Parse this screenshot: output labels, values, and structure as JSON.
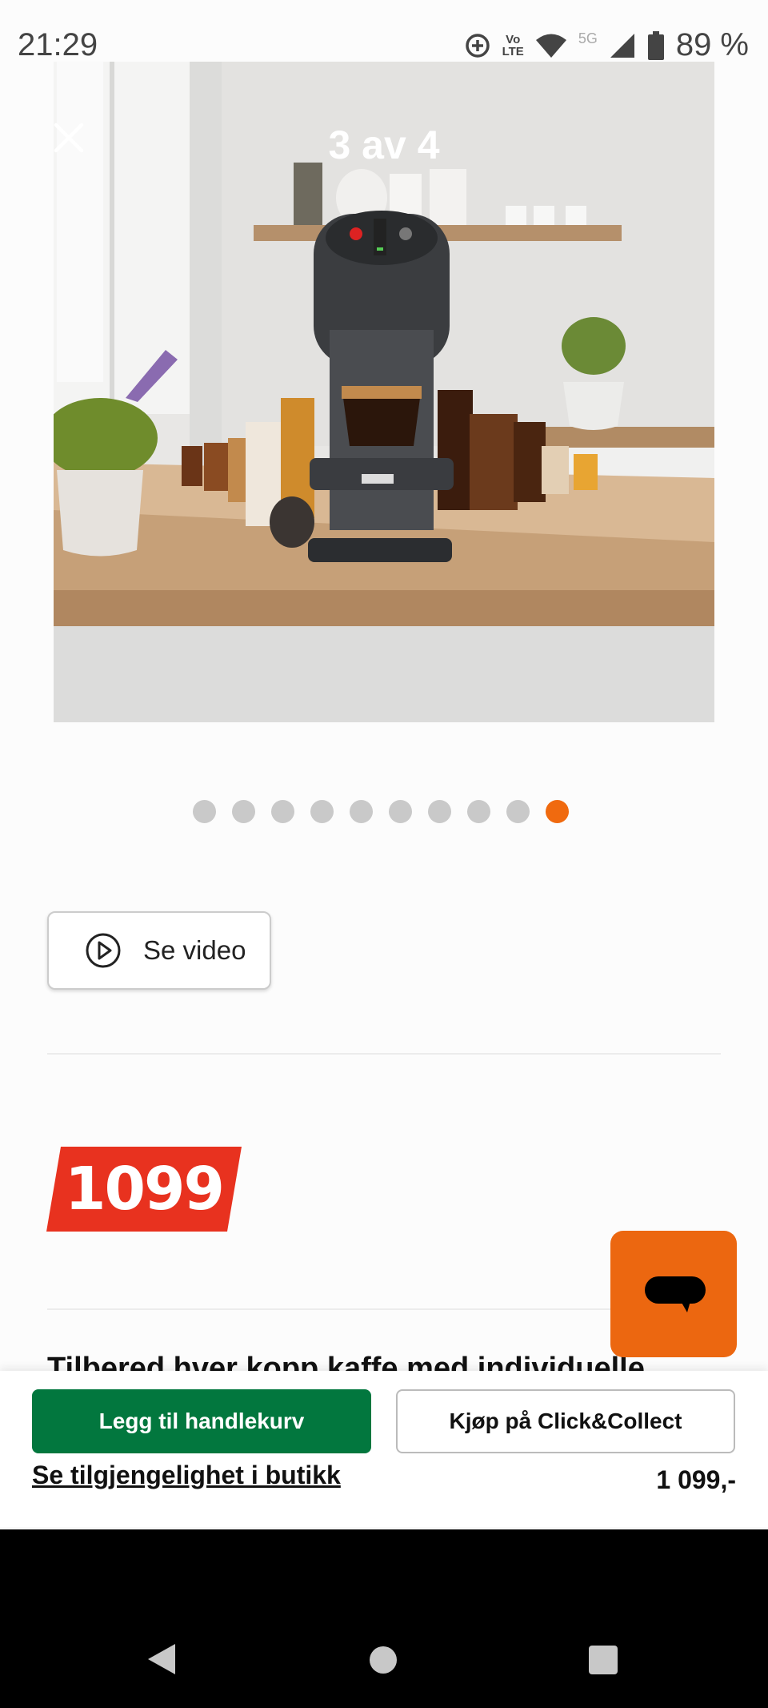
{
  "status_bar": {
    "time": "21:29",
    "network_label_top": "Vo",
    "network_label_bottom": "LTE",
    "fiveg": "5G",
    "battery": "89 %",
    "icons": [
      "data-saver-icon",
      "volte-icon",
      "wifi-icon",
      "signal-icon",
      "battery-icon"
    ]
  },
  "gallery": {
    "counter": "3 av 4",
    "close_icon": "close-icon",
    "image_name": "dolce-gusto-coffee-machine-kitchen-photo",
    "dot_count": 10,
    "active_dot": 9
  },
  "video_button": {
    "label": "Se video",
    "icon": "play-circle-icon"
  },
  "price": {
    "value": "1099",
    "tag_color": "#e8321f"
  },
  "description_peek": "Tilbered hver kopp kaffe med individuelle",
  "chat_button": {
    "icon": "chat-bubble-icon",
    "color": "#ec6710"
  },
  "bottom_bar": {
    "cart_button": "Legg til handlekurv",
    "click_collect_button": "Kjøp på Click&Collect",
    "availability_link": "Se tilgjengelighet i butikk",
    "price": "1 099,-",
    "primary_color": "#02773e"
  },
  "nav": {
    "back": "back-icon",
    "home": "home-icon",
    "recent": "recents-icon"
  }
}
